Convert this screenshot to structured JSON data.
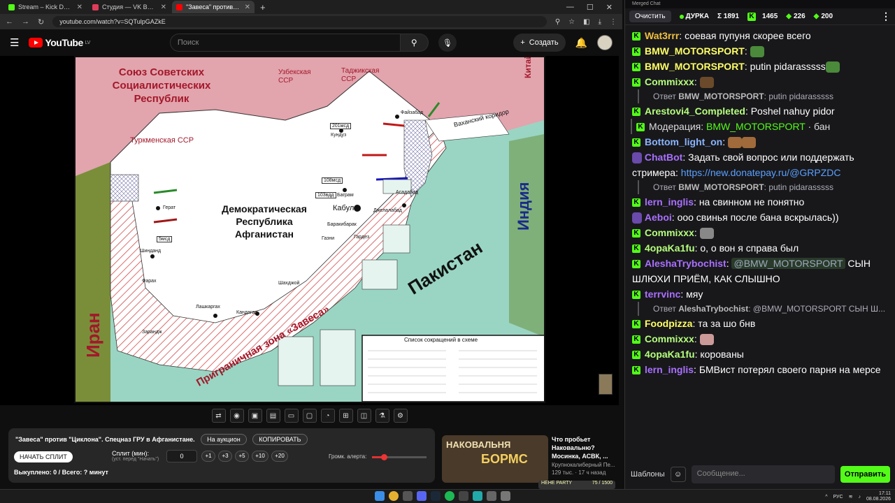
{
  "browser": {
    "tabs": [
      {
        "label": "Stream – Kick Dashboard",
        "color": "#53fc18"
      },
      {
        "label": "Студия — VK Видео Live",
        "color": "#e03c5a"
      },
      {
        "label": "\"Завеса\" против \"Циклона\"",
        "color": "#ff0000"
      }
    ],
    "url": "youtube.com/watch?v=SQTulpGAZkE",
    "new_tab": "+"
  },
  "youtube": {
    "logo": "YouTube",
    "region": "LV",
    "search_placeholder": "Поиск",
    "create_label": "Создать"
  },
  "map": {
    "region_ussr": "Союз Советских Социалистических Республик",
    "uzbek": "Узбекская ССР",
    "tajik": "Таджикская ССР",
    "turkmen": "Туркменская ССР",
    "china": "Китай",
    "india": "Индия",
    "pakistan": "Пакистан",
    "iran": "Иран",
    "dra": "Демократическая Республика Афганистан",
    "zone": "Приграничная зона «Завеса»",
    "corridor": "Ваханский коридор",
    "cities": [
      "Файзабад",
      "Кундуз",
      "Баграм",
      "Кабул",
      "Асадабад",
      "Джелалабад",
      "Баракибарак",
      "Газни",
      "Гардез",
      "Герат",
      "Шинданд",
      "Фарах",
      "Шахджой",
      "Лашкаргах",
      "Кандагар",
      "Зарандж"
    ],
    "units": [
      "201мсд",
      "108мсд",
      "103вдд",
      "5мсд"
    ],
    "legend_title": "Список сокращений в схеме"
  },
  "panel": {
    "title": "\"Завеса\" против \"Циклона\". Спецназ ГРУ в Афганистане.",
    "auction": "На аукцион",
    "copy": "КОПИРОВАТЬ",
    "start": "НАЧАТЬ СПЛИТ",
    "split_label": "Сплит (мин):",
    "split_hint": "(уст. перед \"Начать\")",
    "split_value": "0",
    "inc": [
      "+1",
      "+3",
      "+5",
      "+10",
      "+20"
    ],
    "volume_label": "Громк. алерта:",
    "volume_level": 0.22,
    "bought": "Выкуплено: 0 / Всего: ? минут"
  },
  "recommendation": {
    "thumb_top": "НАКОВАЛЬНЯ",
    "thumb_main": "БОРМС",
    "title": "Что пробьет Наковальню? Мосинка, АСВК, ...",
    "channel": "Крупнокалиберный Пе...",
    "meta": "129 тыс. · 17 ч назад",
    "emote_bar": "HEHE PARTY",
    "emote_count": "75 / 1500"
  },
  "chat": {
    "window_title": "Merged Chat",
    "clear": "Очистить",
    "streamer": "ДУРКА",
    "stats": [
      "Σ 1891",
      "1465",
      "226",
      "200"
    ],
    "messages": [
      {
        "user": "Wat3rrr",
        "color": "#f0c040",
        "text": "соевая пупуня скорее всего"
      },
      {
        "user": "BMW_MOTORSPORT",
        "color": "#ffff66",
        "text": ""
      },
      {
        "user": "BMW_MOTORSPORT",
        "color": "#ffff66",
        "text": "putin pidarasssss"
      },
      {
        "user": "Commixxx",
        "color": "#b6ff7c",
        "text": ""
      },
      {
        "reply_user": "BMW_MOTORSPORT",
        "reply_text": "putin pidarasssss"
      },
      {
        "user": "Arestovi4_Completed",
        "color": "#b6ff7c",
        "text": "Poshel nahuy pidor"
      },
      {
        "moderation": "Модерация:",
        "mod_user": "BMW_MOTORSPORT",
        "mod_action": "· бан"
      },
      {
        "user": "Bottom_light_on",
        "color": "#8ab4ff",
        "text": ""
      },
      {
        "user": "ChatBot",
        "color": "#a970ff",
        "text": "Задать свой вопрос или поддержать стримера:",
        "link": "https://new.donatepay.ru/@GRPZDC"
      },
      {
        "reply_user": "BMW_MOTORSPORT",
        "reply_text": "putin pidarasssss"
      },
      {
        "user": "lern_inglis",
        "color": "#a970ff",
        "text": "на свинном не понятно"
      },
      {
        "user": "Aeboi",
        "color": "#a970ff",
        "text": "ооо свинья после бана вскрылась))"
      },
      {
        "user": "Commixxx",
        "color": "#b6ff7c",
        "text": ""
      },
      {
        "user": "4opaKa1fu",
        "color": "#b6ff7c",
        "text": "о, о вон я справа был"
      },
      {
        "user": "AleshaTrybochist",
        "color": "#a970ff",
        "mention": "@BMW_MOTORSPORT",
        "text": "СЫН ШЛЮХИ ПРИЁМ, КАК СЛЫШНО"
      },
      {
        "user": "terrvinc",
        "color": "#a970ff",
        "text": "мяу"
      },
      {
        "reply_user": "AleshaTrybochist",
        "reply_text": "@BMW_MOTORSPORT СЫН Ш..."
      },
      {
        "user": "Foodpizza",
        "color": "#ffff66",
        "text": "та за шо бнв"
      },
      {
        "user": "Commixxx",
        "color": "#b6ff7c",
        "text": ""
      },
      {
        "user": "4opaKa1fu",
        "color": "#b6ff7c",
        "text": "корованы"
      },
      {
        "user": "lern_inglis",
        "color": "#a970ff",
        "text": "БМВист потерял своего парня на мерсе"
      }
    ],
    "reply_prefix": "Ответ",
    "templates": "Шаблоны",
    "input_placeholder": "Сообщение...",
    "send": "Отправить"
  },
  "taskbar": {
    "lang": "РУС",
    "time": "17:11",
    "date": "08.08.2026"
  }
}
